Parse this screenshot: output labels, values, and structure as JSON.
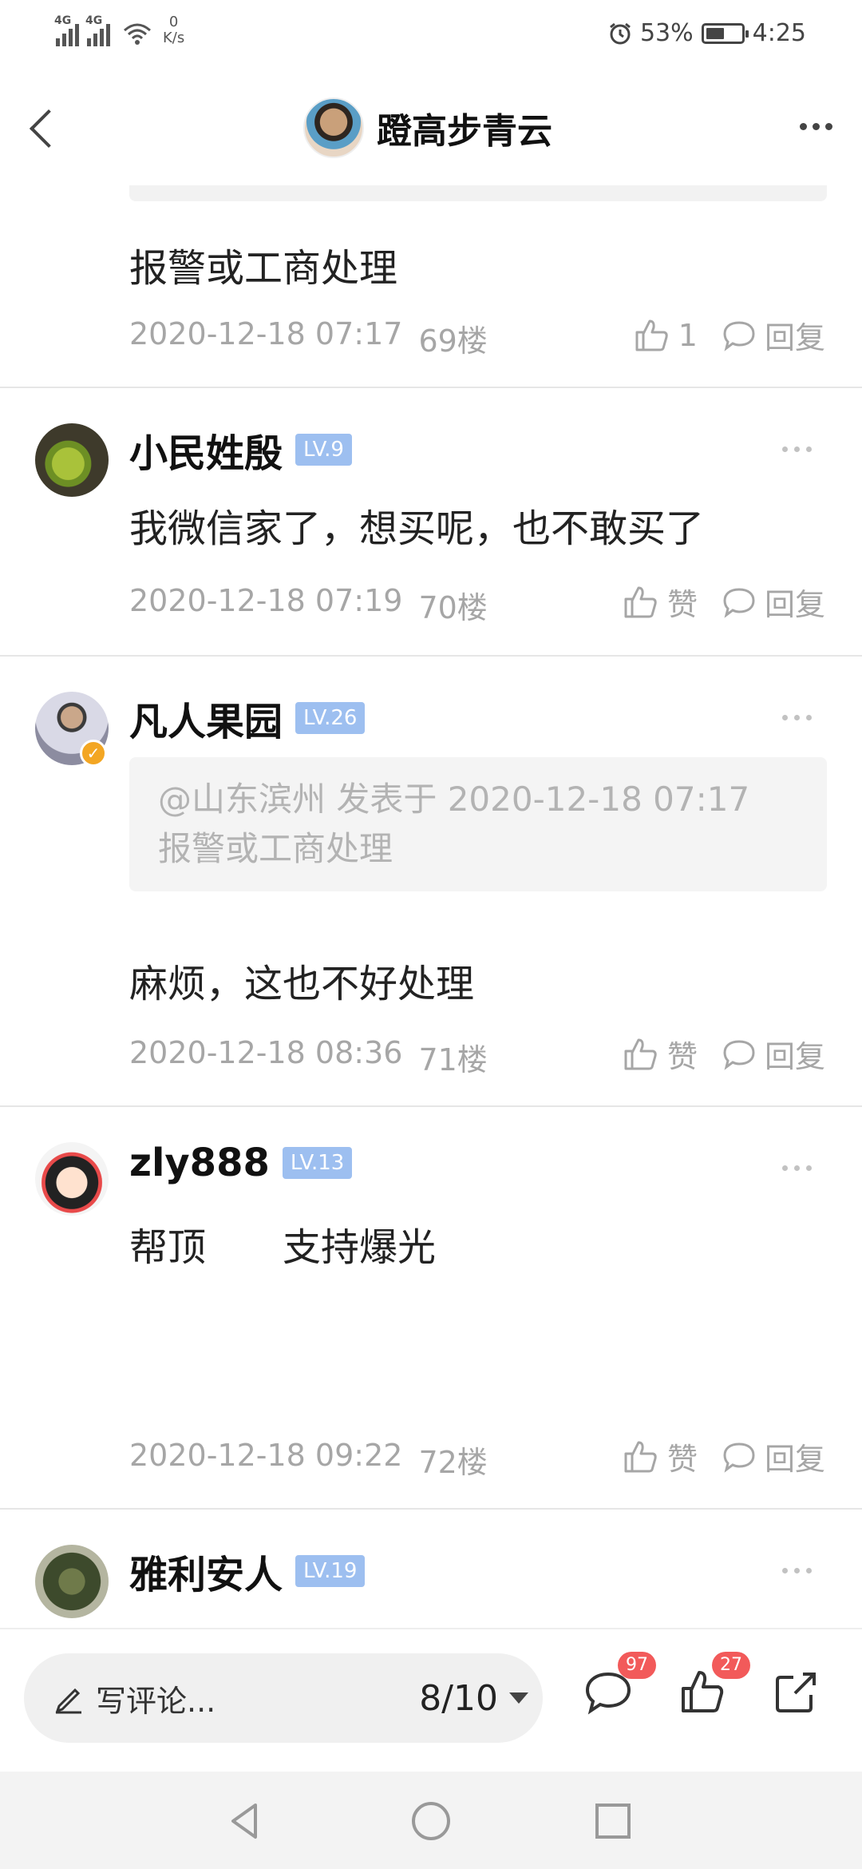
{
  "status_bar": {
    "signal_1": "4G",
    "signal_2": "4G",
    "net_speed_value": "0",
    "net_speed_unit": "K/s",
    "battery": "53%",
    "time": "4:25",
    "icons": [
      "signal-icon",
      "wifi-icon",
      "alarm-icon",
      "battery-icon"
    ]
  },
  "header": {
    "title": "蹬高步青云",
    "icons": [
      "back-icon",
      "more-icon"
    ]
  },
  "comments": [
    {
      "text": "报警或工商处理",
      "date": "2020-12-18 07:17",
      "floor": "69楼",
      "like_label": "1",
      "reply_label": "回复"
    },
    {
      "username": "小民姓殷",
      "level": "LV.9",
      "text": "我微信家了，想买呢，也不敢买了",
      "date": "2020-12-18 07:19",
      "floor": "70楼",
      "like_label": "赞",
      "reply_label": "回复"
    },
    {
      "username": "凡人果园",
      "level": "LV.26",
      "quote_header": "@山东滨州 发表于 2020-12-18 07:17",
      "quote_text": "报警或工商处理",
      "text": "麻烦，这也不好处理",
      "date": "2020-12-18 08:36",
      "floor": "71楼",
      "like_label": "赞",
      "reply_label": "回复"
    },
    {
      "username": "zly888",
      "level": "LV.13",
      "text": "帮顶　　支持爆光",
      "date": "2020-12-18 09:22",
      "floor": "72楼",
      "like_label": "赞",
      "reply_label": "回复"
    },
    {
      "username": "雅利安人",
      "level": "LV.19"
    }
  ],
  "bottom_bar": {
    "placeholder": "写评论...",
    "page": "8/10",
    "comment_count": "97",
    "like_count": "27",
    "icons": [
      "pencil-icon",
      "comment-icon",
      "like-icon",
      "share-icon"
    ]
  },
  "nav_bar": {
    "icons": [
      "back-triangle-icon",
      "home-circle-icon",
      "recents-square-icon"
    ]
  },
  "colors": {
    "level_badge": "#9dbff0",
    "count_badge": "#f25a5a",
    "meta_text": "#a6a6a6"
  }
}
